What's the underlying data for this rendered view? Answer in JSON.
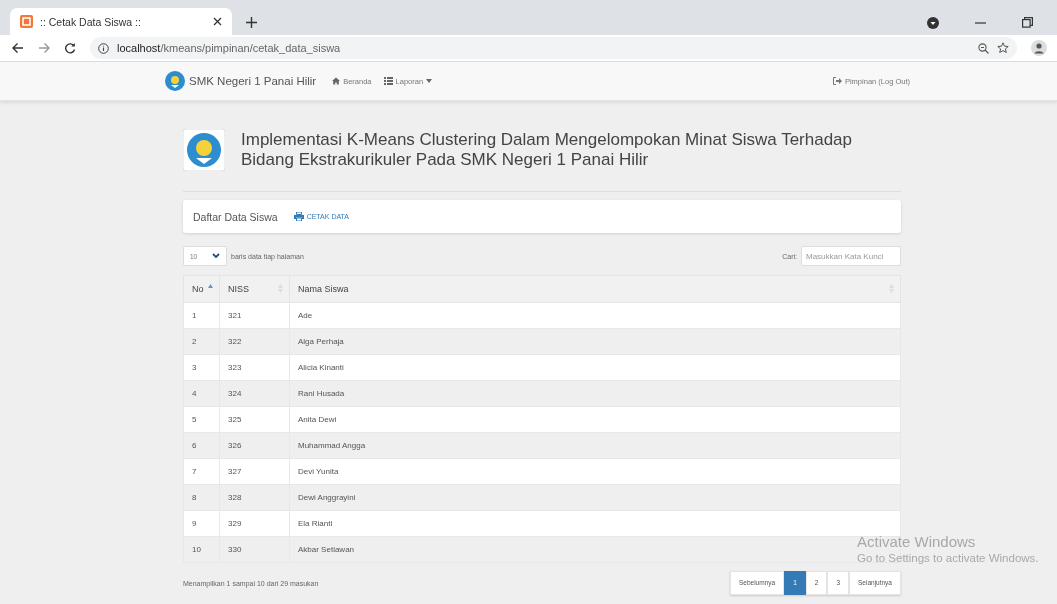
{
  "browser": {
    "tab_title": ":: Cetak Data Siswa ::",
    "url_host": "localhost",
    "url_path": "/kmeans/pimpinan/cetak_data_siswa"
  },
  "navbar": {
    "brand": "SMK Negeri 1 Panai Hilir",
    "items": [
      {
        "label": "Beranda",
        "kind": "home"
      },
      {
        "label": "Laporan",
        "kind": "dropdown"
      }
    ],
    "user": "Pimpinan (Log Out)"
  },
  "heading": "Implementasi K-Means Clustering Dalam Mengelompokan Minat Siswa Terhadap Bidang Ekstrakurikuler Pada SMK Negeri 1 Panai Hilir",
  "panel": {
    "title": "Daftar Data Siswa",
    "action": "CETAK DATA"
  },
  "length": {
    "value": "10",
    "label": "baris data tiap halaman"
  },
  "search": {
    "label": "Cari:",
    "placeholder": "Masukkan Kata Kunci"
  },
  "table": {
    "columns": [
      {
        "label": "No",
        "sorted": true
      },
      {
        "label": "NISS",
        "sorted": false
      },
      {
        "label": "Nama Siswa",
        "sorted": false
      }
    ],
    "rows": [
      [
        "1",
        "321",
        "Ade"
      ],
      [
        "2",
        "322",
        "Alga Perhaja"
      ],
      [
        "3",
        "323",
        "Alicia Kinanti"
      ],
      [
        "4",
        "324",
        "Rani Husada"
      ],
      [
        "5",
        "325",
        "Anita Dewi"
      ],
      [
        "6",
        "326",
        "Muhammad Angga"
      ],
      [
        "7",
        "327",
        "Devi Yunita"
      ],
      [
        "8",
        "328",
        "Dewi Anggrayini"
      ],
      [
        "9",
        "329",
        "Ela Rianti"
      ],
      [
        "10",
        "330",
        "Akbar Setiawan"
      ]
    ]
  },
  "info": "Menampilkan 1 sampai 10 dari 29 masukan",
  "pagination": [
    {
      "label": "Sebelumnya",
      "selected": false
    },
    {
      "label": "1",
      "selected": true
    },
    {
      "label": "2",
      "selected": false
    },
    {
      "label": "3",
      "selected": false
    },
    {
      "label": "Selanjutnya",
      "selected": false
    }
  ],
  "os_notice": {
    "title": "Activate Windows",
    "text": "Go to Settings to activate Windows."
  }
}
